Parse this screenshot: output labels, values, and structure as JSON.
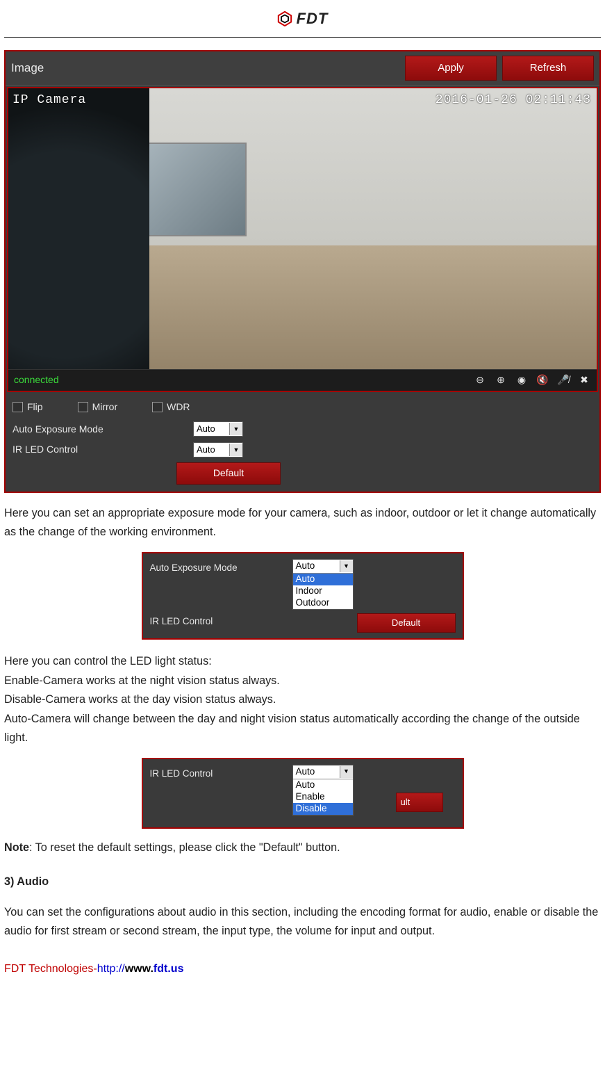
{
  "brand": {
    "name": "FDT"
  },
  "panel": {
    "title": "Image",
    "apply": "Apply",
    "refresh": "Refresh",
    "overlay_camera": "IP Camera",
    "overlay_time": "2016-01-26 02:11:43",
    "status": "connected",
    "checkboxes": {
      "flip": "Flip",
      "mirror": "Mirror",
      "wdr": "WDR"
    },
    "exposure_label": "Auto Exposure Mode",
    "exposure_value": "Auto",
    "ir_label": "IR LED Control",
    "ir_value": "Auto",
    "default": "Default"
  },
  "para1": "Here you can set an appropriate exposure mode for your camera, such as indoor, outdoor or let it change automatically as the change of the working environment.",
  "exposure_dd": {
    "label1": "Auto Exposure Mode",
    "label2": "IR LED Control",
    "selected": "Auto",
    "opts": {
      "o1": "Auto",
      "o2": "Indoor",
      "o3": "Outdoor"
    },
    "default": "Default"
  },
  "para2a": "Here you can control the LED light status:",
  "para2b": "Enable-Camera works at the night vision status always.",
  "para2c": "Disable-Camera works at the day vision status always.",
  "para2d": "Auto-Camera will change between the day and night vision status automatically according the change of the outside light.",
  "ir_dd": {
    "label": "IR LED Control",
    "selected": "Auto",
    "opts": {
      "o1": "Auto",
      "o2": "Enable",
      "o3": "Disable"
    },
    "default_partial": "ult"
  },
  "note_label": "Note",
  "note_text": ": To reset the default settings, please click the \"Default\" button.",
  "audio_heading": "3) Audio",
  "audio_text": "You can set the configurations about audio in this section, including the encoding format for audio, enable or disable the audio for first stream or second stream, the input type, the volume for input and output.",
  "footer": {
    "company": "FDT Technologies-",
    "proto": "http://",
    "www": "www.",
    "domain": "fdt.us"
  }
}
